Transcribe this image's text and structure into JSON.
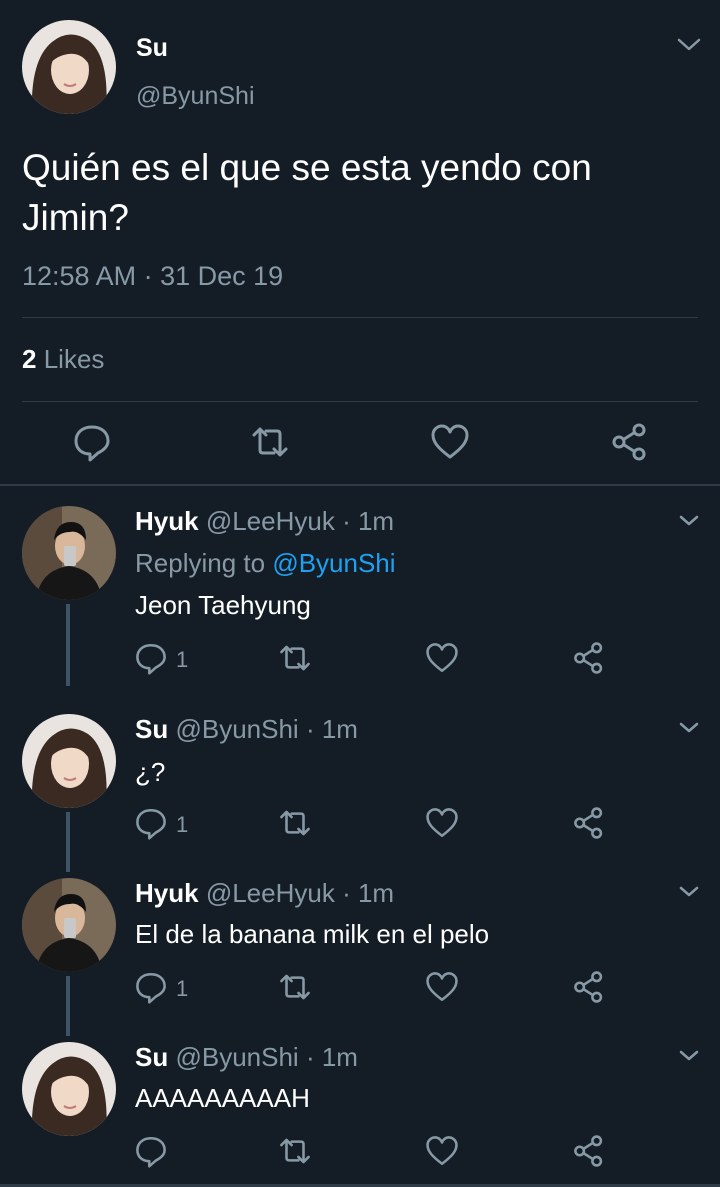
{
  "main_tweet": {
    "name": "Su",
    "handle": "@ByunShi",
    "text": "Quién es el que se esta yendo con Jimin?",
    "timestamp": "12:58 AM · 31 Dec 19",
    "likes_count": "2",
    "likes_label": "Likes"
  },
  "replies": [
    {
      "name": "Hyuk",
      "handle": "@LeeHyuk",
      "time": "· 1m",
      "replying_prefix": "Replying to ",
      "replying_handle": "@ByunShi",
      "text": "Jeon Taehyung",
      "reply_count": "1"
    },
    {
      "name": "Su",
      "handle": "@ByunShi",
      "time": "· 1m",
      "text": "¿?",
      "reply_count": "1"
    },
    {
      "name": "Hyuk",
      "handle": "@LeeHyuk",
      "time": "· 1m",
      "text": "El de la banana milk en el pelo",
      "reply_count": "1"
    },
    {
      "name": "Su",
      "handle": "@ByunShi",
      "time": "· 1m",
      "text": "AAAAAAAAAH",
      "reply_count": ""
    }
  ],
  "colors": {
    "background": "#141d26",
    "secondary_text": "#8899a6",
    "link": "#1da1f2",
    "divider": "#2f3b47",
    "thread_line": "#3d5466"
  },
  "icons": [
    "chevron-down-icon",
    "reply-icon",
    "retweet-icon",
    "like-icon",
    "share-icon"
  ]
}
